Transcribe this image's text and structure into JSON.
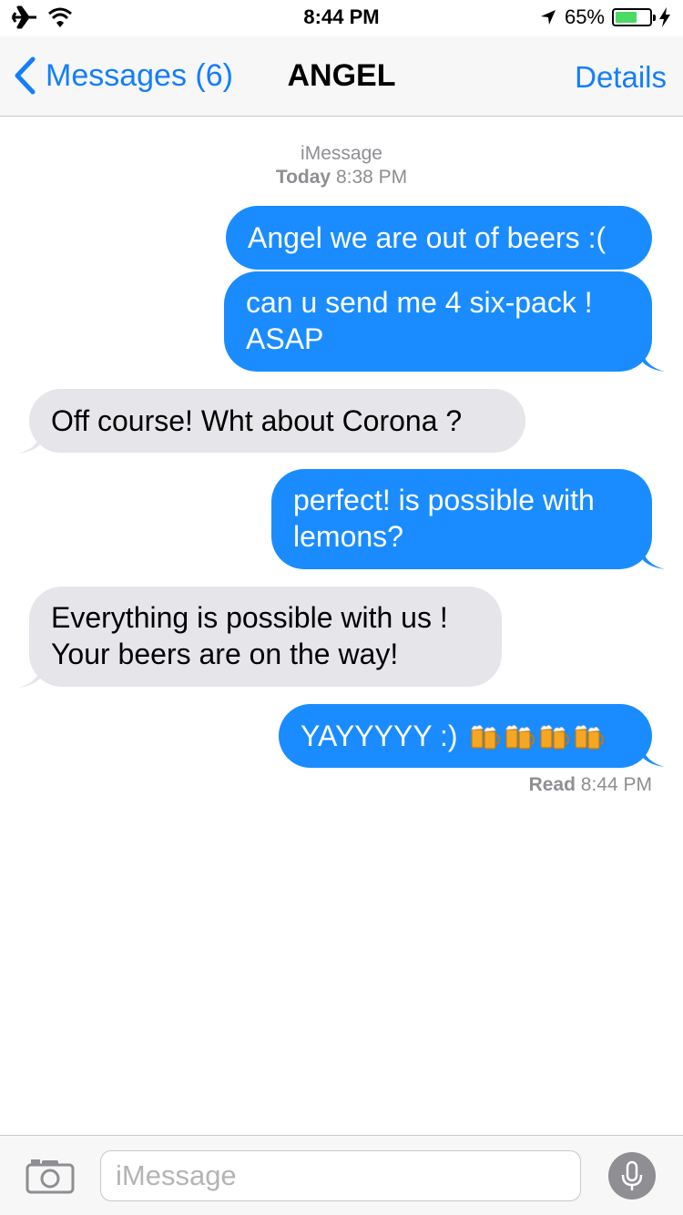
{
  "status_bar": {
    "time": "8:44 PM",
    "battery_percent": "65%",
    "battery_level": 0.65,
    "icons": [
      "airplane-icon",
      "wifi-icon",
      "location-arrow-icon",
      "battery-icon",
      "charging-bolt-icon"
    ]
  },
  "nav": {
    "back_label": "Messages (6)",
    "title": "ANGEL",
    "details_label": "Details"
  },
  "conversation": {
    "service": "iMessage",
    "date_label": "Today",
    "date_time": "8:38 PM",
    "messages": [
      {
        "direction": "out",
        "text": "Angel we are out of beers :("
      },
      {
        "direction": "out",
        "lines": [
          "can u send me 4 six-pack !",
          "ASAP"
        ]
      },
      {
        "direction": "in",
        "text": "Off course! Wht about Corona ?"
      },
      {
        "direction": "out",
        "lines": [
          "perfect! is possible with",
          "lemons?"
        ]
      },
      {
        "direction": "in",
        "lines": [
          "Everything is possible with us !",
          "Your beers are on the way!"
        ]
      },
      {
        "direction": "out",
        "text": "YAYYYYY :)",
        "emoji": [
          "beer-mugs",
          "beer-mugs",
          "beer-mugs",
          "beer-mugs"
        ]
      }
    ],
    "read_label": "Read",
    "read_time": "8:44 PM"
  },
  "input_bar": {
    "placeholder": "iMessage"
  },
  "colors": {
    "accent": "#147efb",
    "outgoing_bubble": "#1a8cff",
    "incoming_bubble": "#e5e5ea",
    "battery": "#4cd964"
  }
}
